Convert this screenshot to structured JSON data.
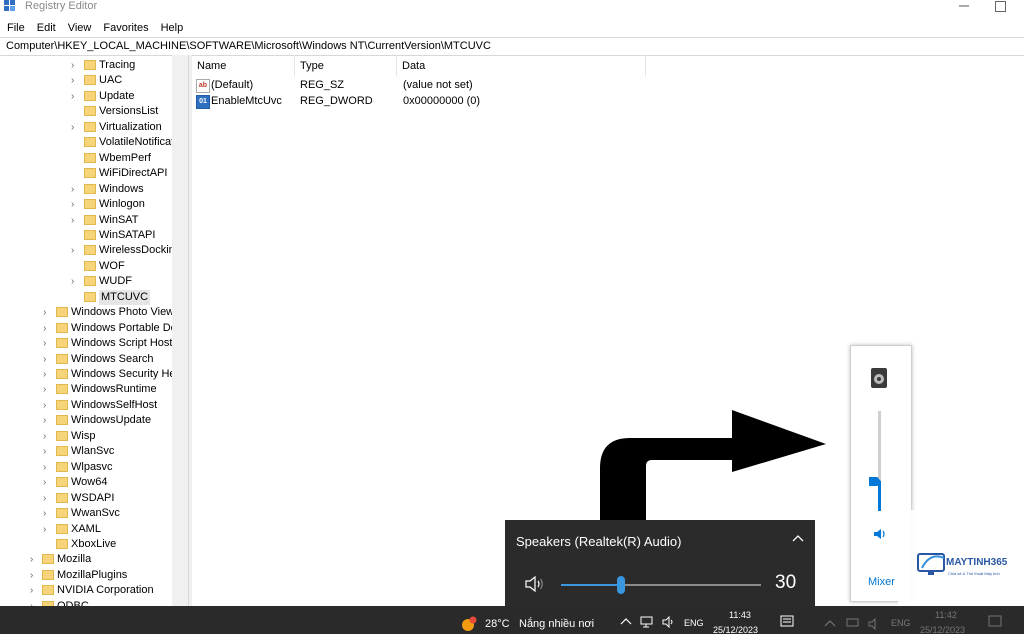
{
  "window": {
    "title": "Registry Editor"
  },
  "menu": [
    "File",
    "Edit",
    "View",
    "Favorites",
    "Help"
  ],
  "address": "Computer\\HKEY_LOCAL_MACHINE\\SOFTWARE\\Microsoft\\Windows NT\\CurrentVersion\\MTCUVC",
  "tree": {
    "items": [
      {
        "label": "Tracing",
        "level": 3,
        "expander": true
      },
      {
        "label": "UAC",
        "level": 3,
        "expander": true
      },
      {
        "label": "Update",
        "level": 3,
        "expander": true
      },
      {
        "label": "VersionsList",
        "level": 3,
        "expander": false
      },
      {
        "label": "Virtualization",
        "level": 3,
        "expander": true
      },
      {
        "label": "VolatileNotificat",
        "level": 3,
        "expander": false
      },
      {
        "label": "WbemPerf",
        "level": 3,
        "expander": false
      },
      {
        "label": "WiFiDirectAPI",
        "level": 3,
        "expander": false
      },
      {
        "label": "Windows",
        "level": 3,
        "expander": true
      },
      {
        "label": "Winlogon",
        "level": 3,
        "expander": true
      },
      {
        "label": "WinSAT",
        "level": 3,
        "expander": true
      },
      {
        "label": "WinSATAPI",
        "level": 3,
        "expander": false
      },
      {
        "label": "WirelessDocking",
        "level": 3,
        "expander": true
      },
      {
        "label": "WOF",
        "level": 3,
        "expander": false
      },
      {
        "label": "WUDF",
        "level": 3,
        "expander": true
      },
      {
        "label": "MTCUVC",
        "level": 3,
        "expander": false,
        "selected": true
      },
      {
        "label": "Windows Photo Viewe",
        "level": 2,
        "expander": true
      },
      {
        "label": "Windows Portable De",
        "level": 2,
        "expander": true
      },
      {
        "label": "Windows Script Host",
        "level": 2,
        "expander": true
      },
      {
        "label": "Windows Search",
        "level": 2,
        "expander": true
      },
      {
        "label": "Windows Security Hea",
        "level": 2,
        "expander": true
      },
      {
        "label": "WindowsRuntime",
        "level": 2,
        "expander": true
      },
      {
        "label": "WindowsSelfHost",
        "level": 2,
        "expander": true
      },
      {
        "label": "WindowsUpdate",
        "level": 2,
        "expander": true
      },
      {
        "label": "Wisp",
        "level": 2,
        "expander": true
      },
      {
        "label": "WlanSvc",
        "level": 2,
        "expander": true
      },
      {
        "label": "Wlpasvc",
        "level": 2,
        "expander": true
      },
      {
        "label": "Wow64",
        "level": 2,
        "expander": true
      },
      {
        "label": "WSDAPI",
        "level": 2,
        "expander": true
      },
      {
        "label": "WwanSvc",
        "level": 2,
        "expander": true
      },
      {
        "label": "XAML",
        "level": 2,
        "expander": true
      },
      {
        "label": "XboxLive",
        "level": 2,
        "expander": false
      },
      {
        "label": "Mozilla",
        "level": 1,
        "expander": true
      },
      {
        "label": "MozillaPlugins",
        "level": 1,
        "expander": true
      },
      {
        "label": "NVIDIA Corporation",
        "level": 1,
        "expander": true
      },
      {
        "label": "ODBC",
        "level": 1,
        "expander": true
      }
    ]
  },
  "values": {
    "headers": {
      "name": "Name",
      "type": "Type",
      "data": "Data"
    },
    "rows": [
      {
        "name": "(Default)",
        "type": "REG_SZ",
        "data": "(value not set)",
        "icon": "string-value-icon"
      },
      {
        "name": "EnableMtcUvc",
        "type": "REG_DWORD",
        "data": "0x00000000 (0)",
        "icon": "dword-value-icon"
      }
    ]
  },
  "volume_flyout": {
    "mixer_label": "Mixer",
    "level_fraction": 0.3
  },
  "speaker_panel": {
    "device": "Speakers (Realtek(R) Audio)",
    "volume": "30",
    "level_fraction": 0.3
  },
  "watermark": {
    "name": "MAYTINH365",
    "tagline": "Chia sẻ & Thủ thuật Máy tính"
  },
  "taskbar": {
    "temp": "28°C",
    "weather": "Nắng nhiều nơi",
    "lang": "ENG",
    "time": "11:43",
    "date": "25/12/2023",
    "ghost_time": "11:42",
    "ghost_date": "25/12/2023"
  },
  "colors": {
    "accent": "#0078d7",
    "folder": "#f5d47a",
    "taskbar": "#2a2a2a",
    "panel": "#2b2b2b"
  }
}
